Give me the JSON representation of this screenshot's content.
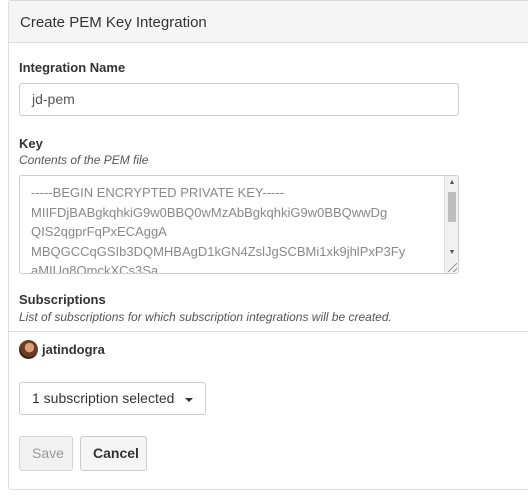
{
  "panel": {
    "title": "Create PEM Key Integration"
  },
  "integration_name": {
    "label": "Integration Name",
    "value": "jd-pem"
  },
  "key": {
    "label": "Key",
    "help": "Contents of the PEM file",
    "value": "-----BEGIN ENCRYPTED PRIVATE KEY-----\nMIIFDjBABgkqhkiG9w0BBQ0wMzAbBgkqhkiG9w0BBQwwDg\nQIS2qgprFqPxECAggA\nMBQGCCqGSIb3DQMHBAgD1kGN4ZslJgSCBMi1xk9jhlPxP3Fy\naMIUg8OmckXCs3Sa"
  },
  "subscriptions": {
    "label": "Subscriptions",
    "help": "List of subscriptions for which subscription integrations will be created.",
    "user": "jatindogra",
    "dropdown_label": "1 subscription selected"
  },
  "actions": {
    "save_label": "Save",
    "cancel_label": "Cancel"
  },
  "icons": {
    "scroll_up": "scroll-up-arrow",
    "scroll_down": "scroll-down-arrow",
    "caret": "chevron-down-icon"
  }
}
